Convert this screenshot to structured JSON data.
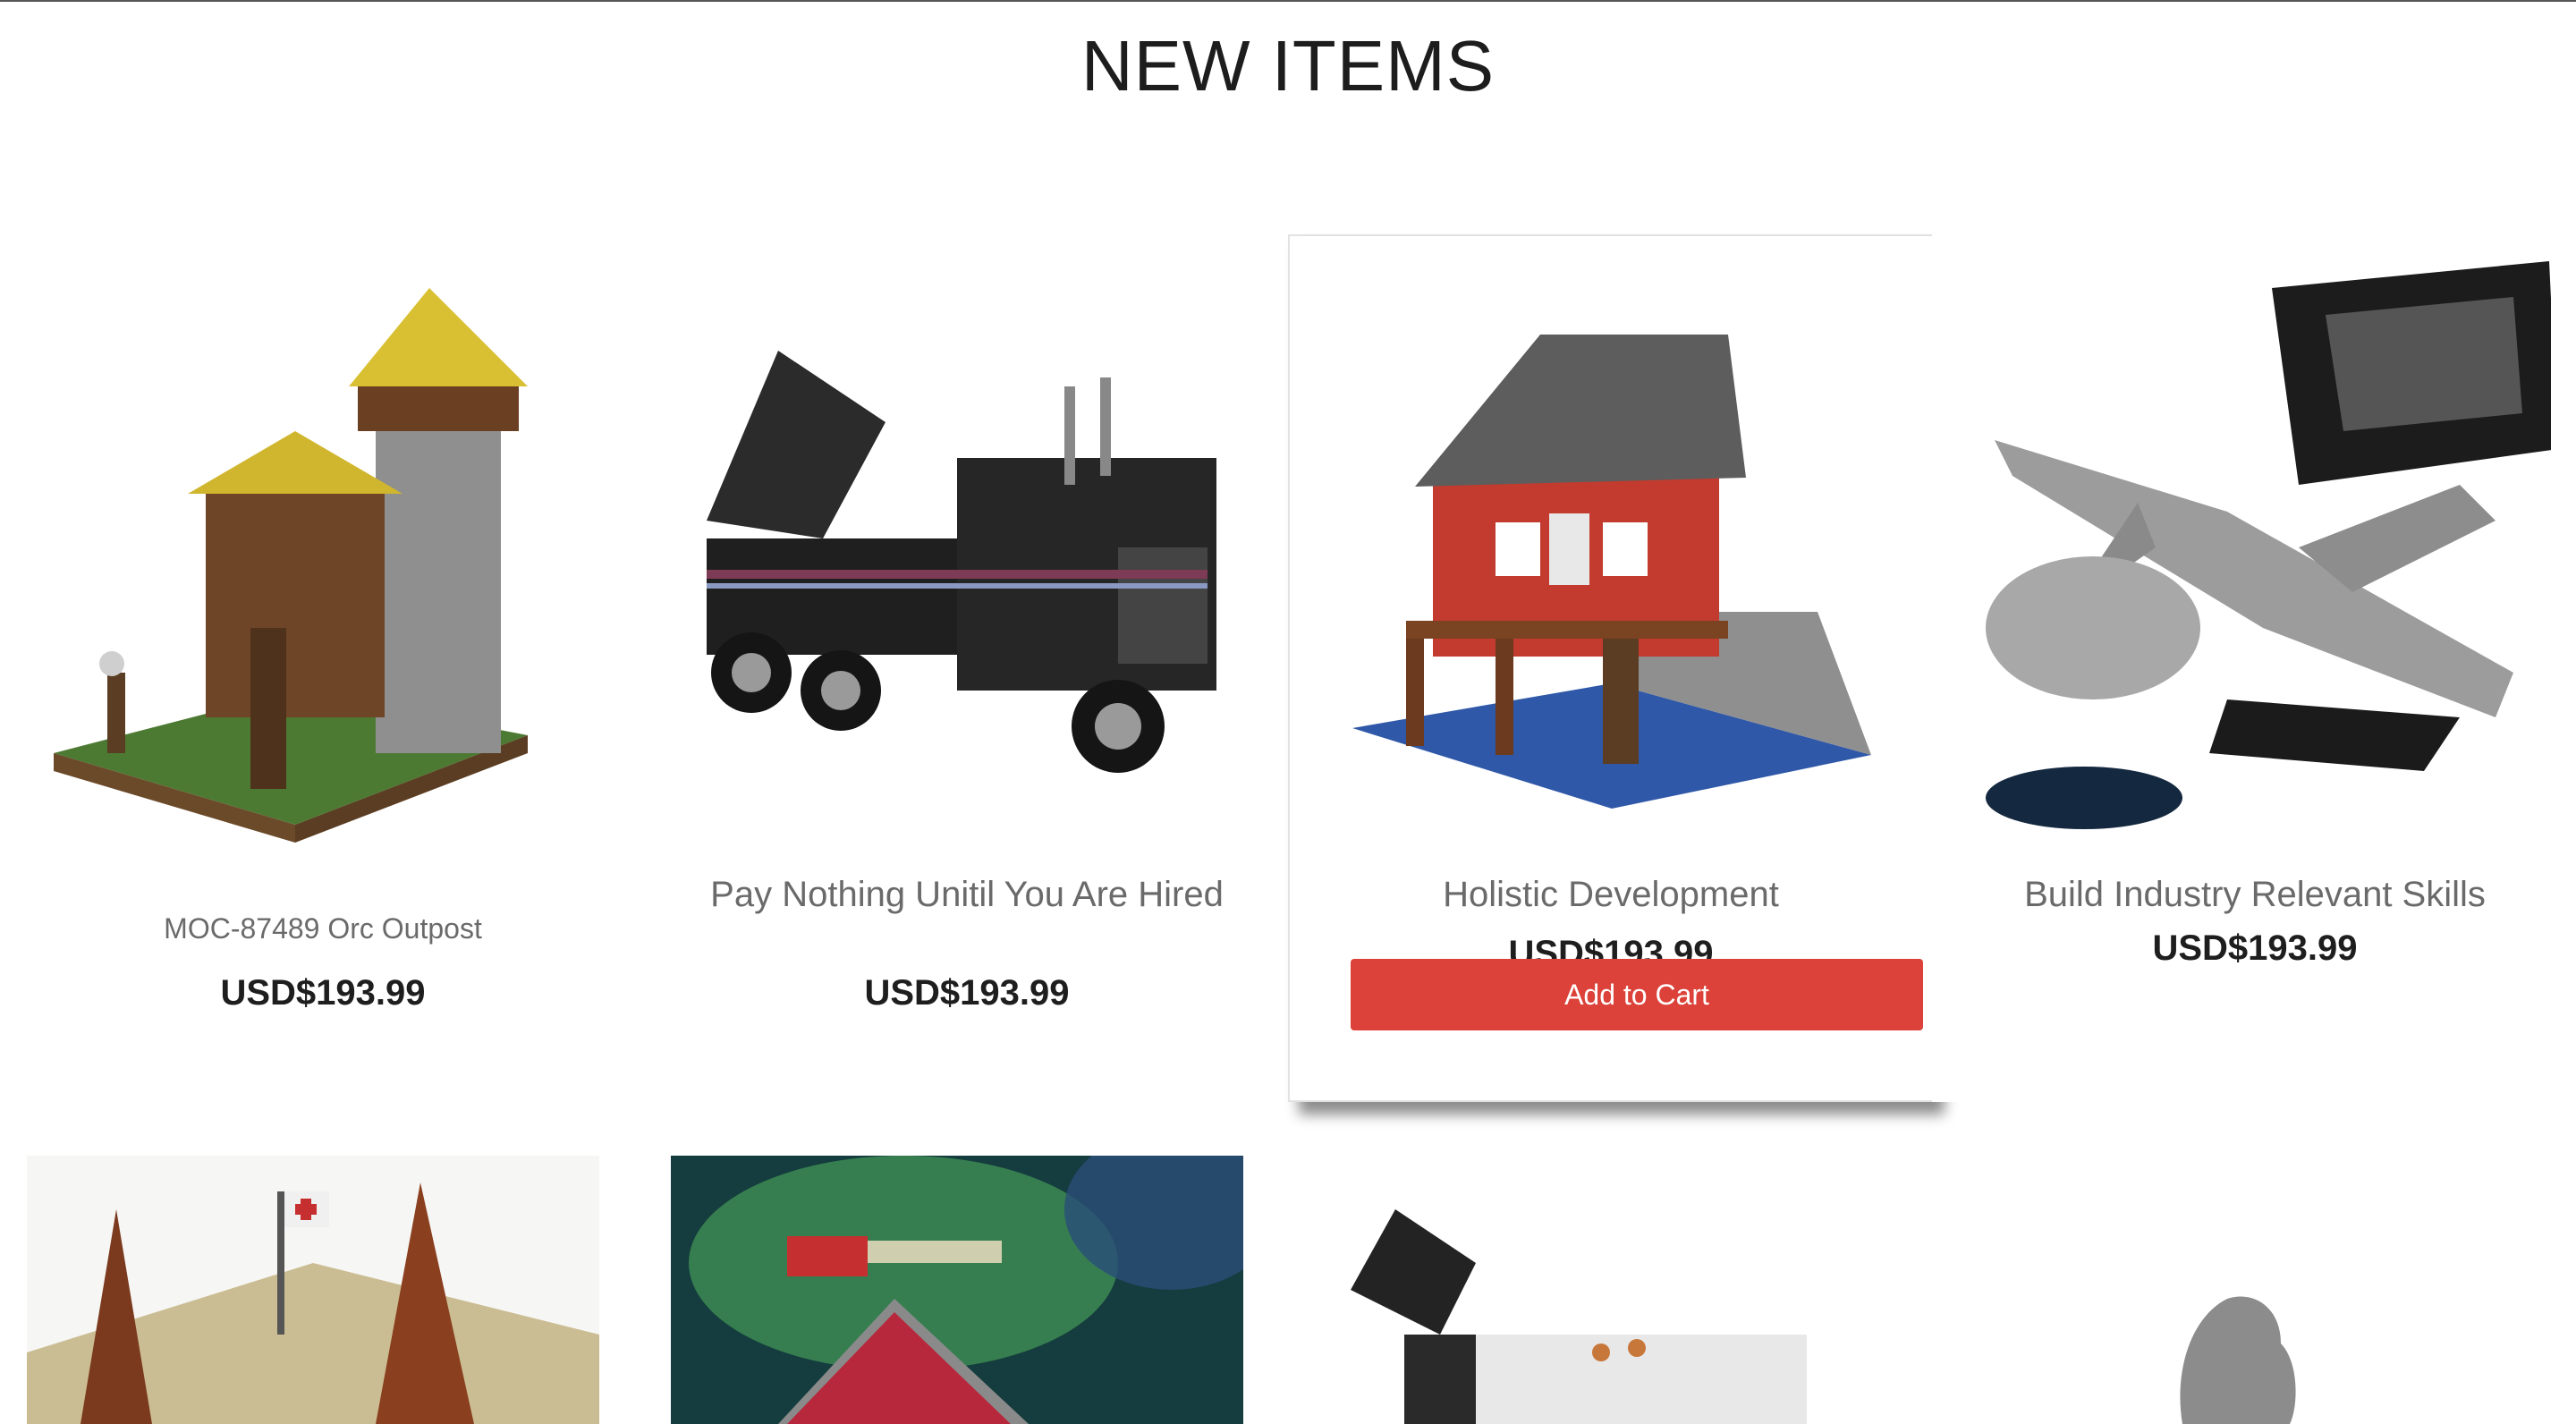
{
  "page": {
    "title": "NEW ITEMS"
  },
  "products": [
    {
      "name": "MOC-87489 Orc Outpost",
      "price": "USD$193.99",
      "icon": "orc-outpost-image"
    },
    {
      "name": "Pay Nothing Unitil You Are Hired",
      "price": "USD$193.99",
      "icon": "tow-truck-image"
    },
    {
      "name": "Holistic Development",
      "price": "USD$193.99",
      "icon": "fishing-cabin-image",
      "button": "Add to Cart"
    },
    {
      "name": "Build Industry Relevant Skills",
      "price": "USD$193.99",
      "icon": "fighter-jet-image"
    }
  ],
  "second_row_icons": [
    "military-camp-image",
    "aurora-sleigh-image",
    "crane-truck-image",
    "grey-figure-image"
  ]
}
